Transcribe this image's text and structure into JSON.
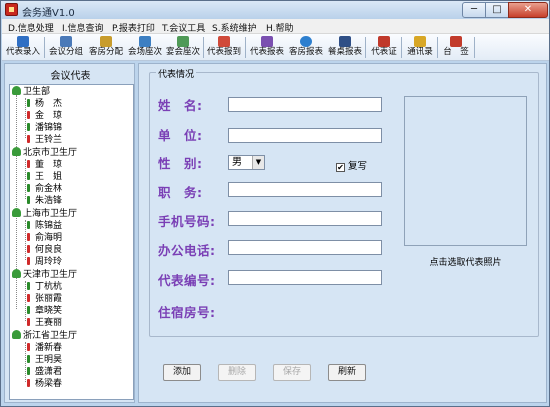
{
  "window": {
    "title": "会务通V1.0",
    "min": "─",
    "max": "□",
    "close": "✕"
  },
  "menu": [
    "D.信息处理",
    "I.信息查询",
    "P.报表打印",
    "T.会议工具",
    "S.系统维护",
    "H.帮助"
  ],
  "toolbar": [
    {
      "label": "代表录入",
      "icon": "representative-entry-icon",
      "color": "#2f6fc4"
    },
    {
      "label": "会议分组",
      "icon": "meeting-group-icon",
      "color": "#4a79b8"
    },
    {
      "label": "客房分配",
      "icon": "room-assign-icon",
      "color": "#c89c2c"
    },
    {
      "label": "会场座次",
      "icon": "venue-seating-icon",
      "color": "#3d7fc2"
    },
    {
      "label": "宴会座次",
      "icon": "banquet-seating-icon",
      "color": "#4f9a57"
    },
    {
      "label": "代表报到",
      "icon": "representative-checkin-icon",
      "color": "#d04a3a"
    },
    {
      "label": "代表报表",
      "icon": "representative-report-icon",
      "color": "#7a4fb0"
    },
    {
      "label": "客房报表",
      "icon": "room-report-icon",
      "color": "#2d7fcf"
    },
    {
      "label": "餐桌报表",
      "icon": "table-report-icon",
      "color": "#2f4f86"
    },
    {
      "label": "代表证",
      "icon": "badge-icon",
      "color": "#c0392b"
    },
    {
      "label": "通讯录",
      "icon": "address-book-icon",
      "color": "#d8a726"
    },
    {
      "label": "台　签",
      "icon": "table-card-icon",
      "color": "#c23b2b"
    }
  ],
  "left_panel": {
    "title": "会议代表",
    "groups": [
      {
        "name": "卫生部",
        "members": [
          "杨　杰",
          "金　琼",
          "潘锦锦",
          "王铃兰"
        ]
      },
      {
        "name": "北京市卫生厅",
        "members": [
          "董　琼",
          "王　姐",
          "俞金林",
          "朱浩锋"
        ]
      },
      {
        "name": "上海市卫生厅",
        "members": [
          "陈锦益",
          "俞海明",
          "何良良",
          "周玲玲"
        ]
      },
      {
        "name": "天津市卫生厅",
        "members": [
          "丁杭杭",
          "张丽霞",
          "章晓笑",
          "王赛丽"
        ]
      },
      {
        "name": "浙江省卫生厅",
        "members": [
          "潘新春",
          "王明昊",
          "盛潇君",
          "杨梁春"
        ]
      }
    ],
    "member_colors": [
      "#2a8a2a",
      "#d02a2a",
      "#2a8a2a",
      "#d02a2a"
    ]
  },
  "form": {
    "groupbox_title": "代表情况",
    "name_label": "姓　名:",
    "unit_label": "单　位:",
    "gender_label": "性　别:",
    "gender_value": "男",
    "gender_arrow": "▼",
    "dup_check_label": "复写",
    "dup_checked": "✔",
    "position_label": "职　务:",
    "mobile_label": "手机号码:",
    "office_phone_label": "办公电话:",
    "rep_no_label": "代表编号:",
    "room_label": "住宿房号:",
    "photo_caption": "点击选取代表照片"
  },
  "buttons": {
    "add": "添加",
    "delete": "删除",
    "save": "保存",
    "refresh": "刷新"
  }
}
